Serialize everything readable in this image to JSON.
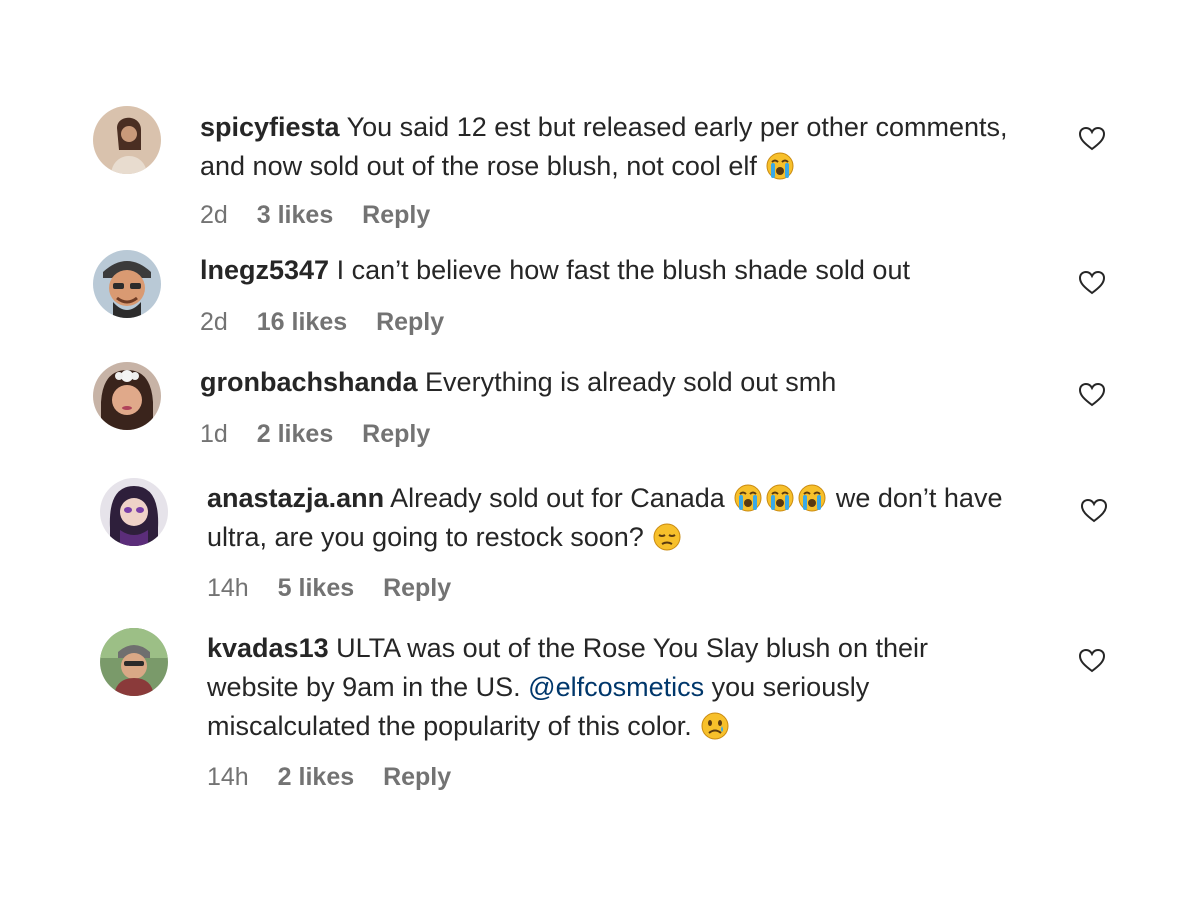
{
  "comments": [
    {
      "username": "spicyfiesta",
      "text_parts": [
        "You said 12 est but released early per other comments, and now sold out of the rose blush, not cool elf"
      ],
      "emojis": [
        "loudly-crying-face-icon"
      ],
      "time": "2d",
      "likes": "3 likes",
      "reply": "Reply"
    },
    {
      "username": "lnegz5347",
      "text_parts": [
        "I can’t believe how fast the blush shade sold out"
      ],
      "time": "2d",
      "likes": "16 likes",
      "reply": "Reply"
    },
    {
      "username": "gronbachshanda",
      "text_parts": [
        "Everything is already sold out smh"
      ],
      "time": "1d",
      "likes": "2 likes",
      "reply": "Reply"
    },
    {
      "username": "anastazja.ann",
      "text_parts": [
        "Already sold out for Canada",
        "we don’t have ultra, are you going to restock soon?"
      ],
      "emojis": [
        "loudly-crying-face-icon",
        "loudly-crying-face-icon",
        "loudly-crying-face-icon",
        "pensive-face-icon"
      ],
      "time": "14h",
      "likes": "5 likes",
      "reply": "Reply"
    },
    {
      "username": "kvadas13",
      "text_parts": [
        "ULTA was out of the Rose You Slay blush on their website by 9am in the US.",
        "@elfcosmetics",
        "you seriously miscalculated the popularity of this color."
      ],
      "emojis": [
        "sad-face-icon"
      ],
      "time": "14h",
      "likes": "2 likes",
      "reply": "Reply"
    }
  ],
  "colors": {
    "text": "#262626",
    "meta": "#737373",
    "mention": "#00376b",
    "emoji_face": "#f7c02b",
    "emoji_tears": "#3aa9e6"
  }
}
